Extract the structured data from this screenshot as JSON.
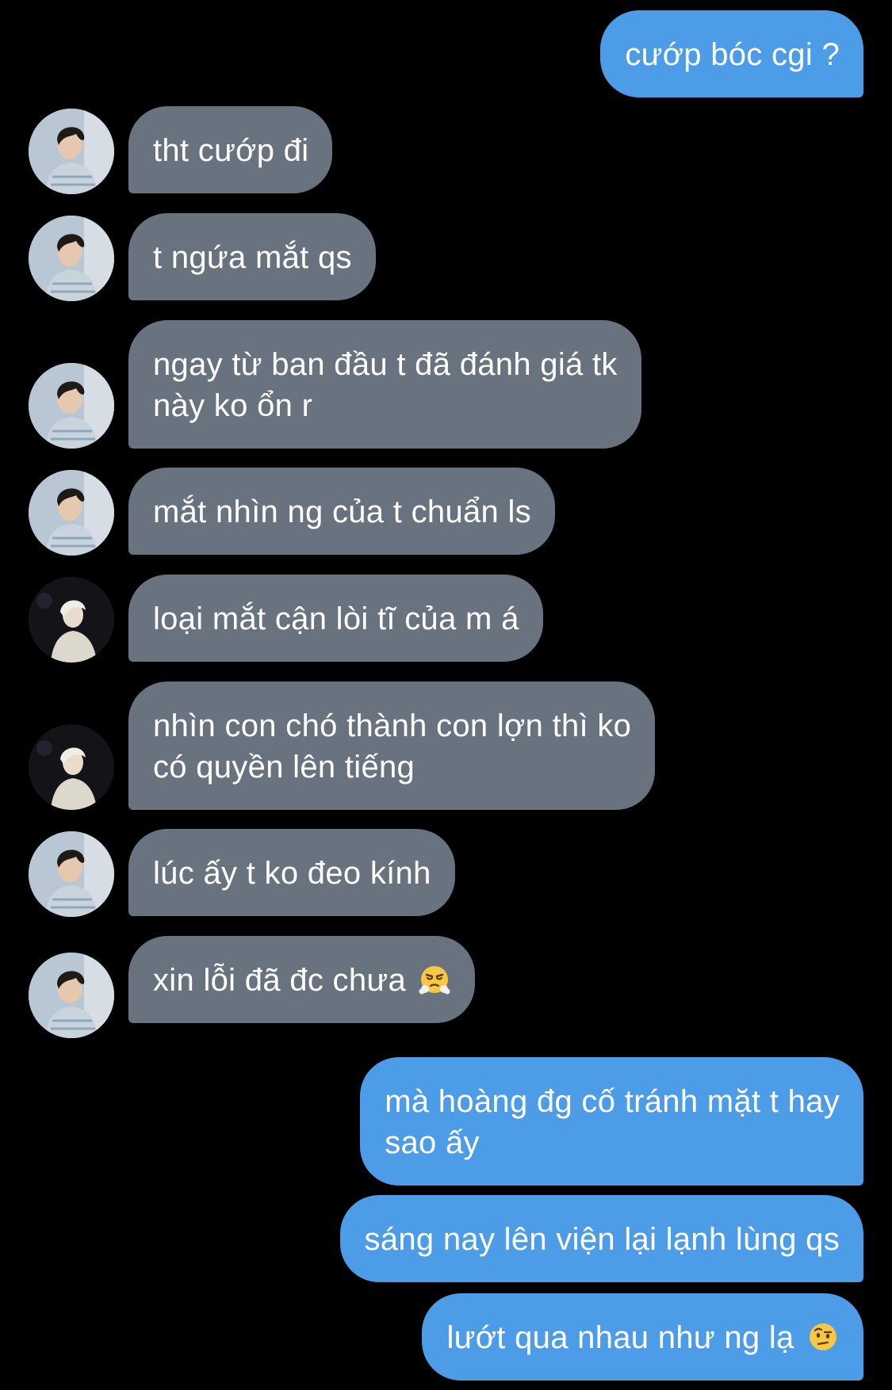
{
  "conversation": {
    "messages": [
      {
        "sender": "me",
        "text": "cướp bóc cgi ?"
      },
      {
        "sender": "friend-a",
        "text": "tht cướp đi"
      },
      {
        "sender": "friend-a",
        "text": "t ngứa mắt qs"
      },
      {
        "sender": "friend-a",
        "lines": [
          "ngay từ ban đầu t đã đánh giá tk",
          "này ko ổn r"
        ]
      },
      {
        "sender": "friend-a",
        "text": "mắt nhìn ng của t chuẩn ls"
      },
      {
        "sender": "friend-b",
        "text": "loại mắt cận lòi tĩ của m á"
      },
      {
        "sender": "friend-b",
        "lines": [
          "nhìn con chó thành con lợn thì ko",
          "có quyền lên tiếng"
        ]
      },
      {
        "sender": "friend-a",
        "text": "lúc ấy t ko đeo kính"
      },
      {
        "sender": "friend-a",
        "text": "xin lỗi đã đc chưa",
        "emoji": "face-with-steam-from-nose"
      },
      {
        "sender": "me",
        "lines": [
          "mà hoàng đg cố tránh mặt t hay",
          "sao ấy"
        ]
      },
      {
        "sender": "me",
        "text": "sáng nay lên viện lại lạnh lùng qs"
      },
      {
        "sender": "me",
        "text": "lướt qua nhau như ng lạ",
        "emoji": "face-with-raised-eyebrow"
      }
    ]
  },
  "colors": {
    "background": "#000000",
    "incoming_bubble": "#68737f",
    "outgoing_bubble": "#4c9ce8",
    "text": "#ffffff"
  }
}
